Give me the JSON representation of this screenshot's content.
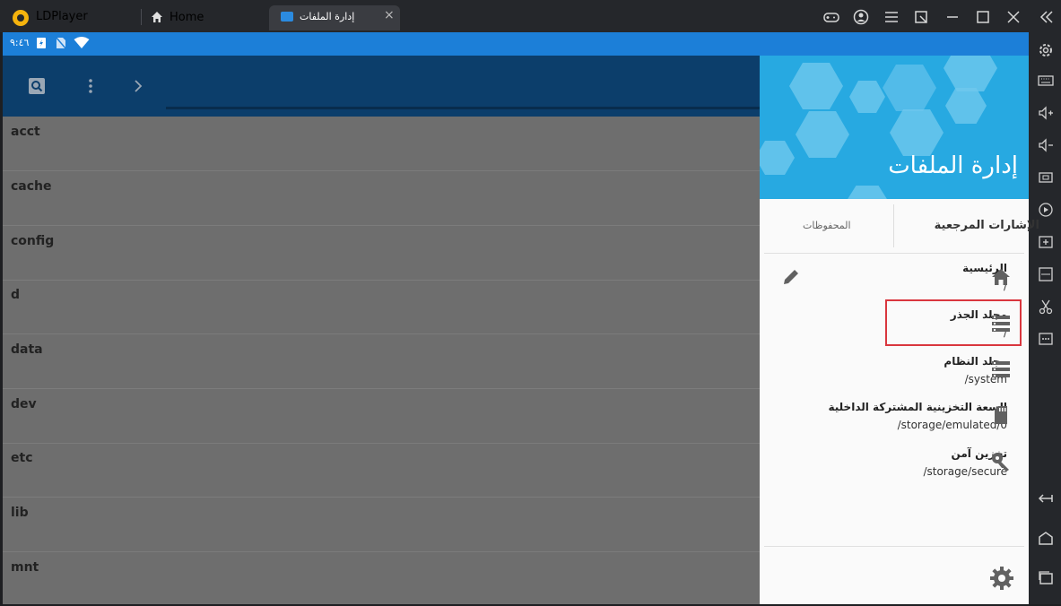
{
  "window": {
    "app_name": "LDPlayer",
    "tabs": [
      {
        "label": "Home"
      },
      {
        "label": "إدارة الملفات",
        "active": true
      }
    ],
    "close_tab_glyph": "×"
  },
  "statusbar": {
    "time": "٩:٤٦"
  },
  "file_list": {
    "items": [
      "acct",
      "cache",
      "config",
      "d",
      "data",
      "dev",
      "etc",
      "lib",
      "mnt"
    ]
  },
  "drawer": {
    "title": "إدارة الملفات",
    "tabs": {
      "bookmarks": "الإشارات المرجعية",
      "saved": "المحفوظات"
    },
    "items": [
      {
        "title": "الرئيسية",
        "path": "/",
        "icon": "home-icon"
      },
      {
        "title": "مجلد الجذر",
        "path": "/",
        "icon": "storage-list-icon"
      },
      {
        "title": "مجلد النظام",
        "path": "/system",
        "icon": "storage-list-icon"
      },
      {
        "title": "السعة التخزينية المشتركة الداخلية",
        "path": "/storage/emulated/0",
        "icon": "sd-card-icon"
      },
      {
        "title": "تخزين آمن",
        "path": "/storage/secure",
        "icon": "key-icon"
      }
    ]
  },
  "colors": {
    "status_bar": "#1c7fd8",
    "app_bar": "#0c3e6b",
    "drawer_header": "#27a9e1",
    "highlight": "#d9363e"
  }
}
